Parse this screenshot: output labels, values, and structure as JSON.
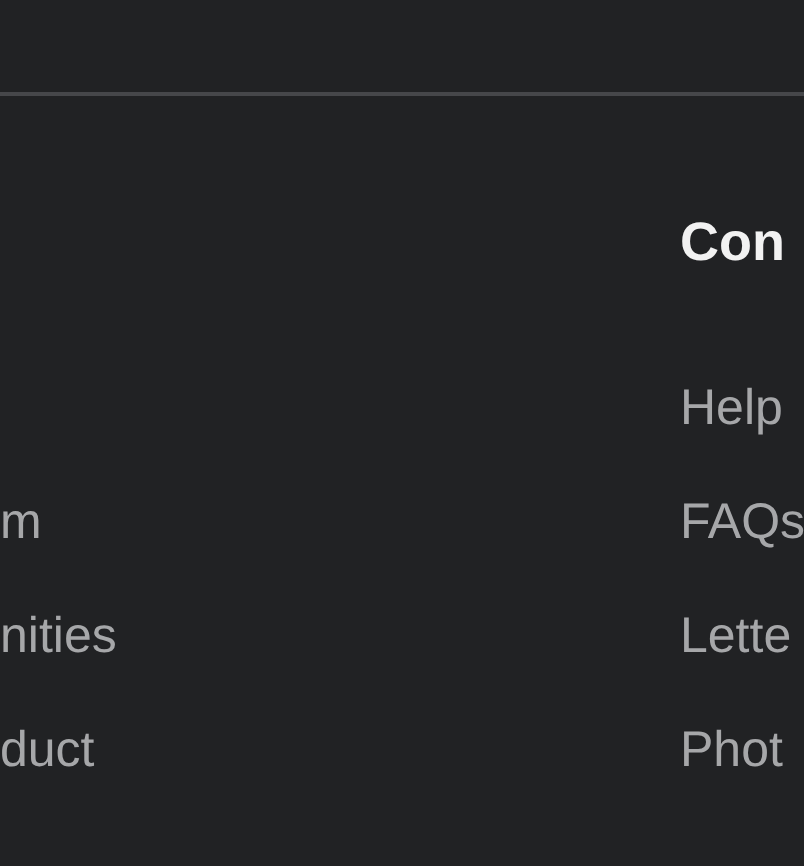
{
  "left_column": {
    "links": [
      "m",
      "nities",
      "duct"
    ]
  },
  "right_column": {
    "heading": "Con",
    "links": [
      "Help",
      "FAQs",
      "Lette",
      "Phot"
    ]
  }
}
